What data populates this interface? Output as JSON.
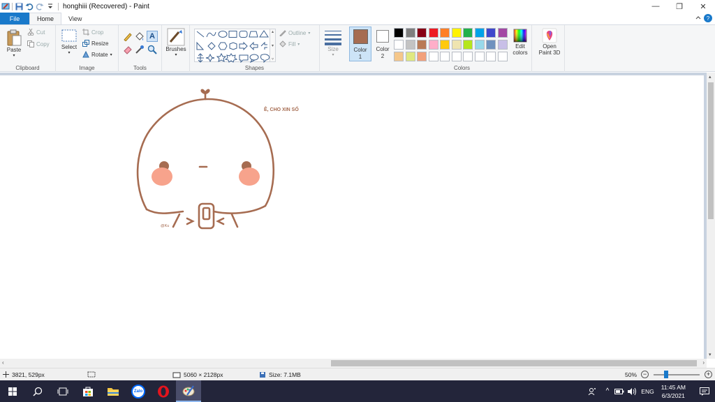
{
  "title_bar": {
    "document_title": "honghiii (Recovered) - Paint",
    "qat_icons": [
      "paint-app-icon",
      "save-icon",
      "undo-icon",
      "redo-icon",
      "customize-qat-icon"
    ],
    "minimize": "—",
    "maximize": "❐",
    "close": "✕"
  },
  "tabs": [
    "File",
    "Home",
    "View"
  ],
  "active_tab": "Home",
  "ribbon": {
    "clipboard": {
      "label": "Clipboard",
      "paste": "Paste",
      "cut": "Cut",
      "copy": "Copy"
    },
    "image": {
      "label": "Image",
      "select": "Select",
      "crop": "Crop",
      "resize": "Resize",
      "rotate": "Rotate"
    },
    "tools": {
      "label": "Tools"
    },
    "brushes": {
      "label": "Brushes"
    },
    "shapes": {
      "label": "Shapes",
      "outline": "Outline",
      "fill": "Fill"
    },
    "size": {
      "label": "Size"
    },
    "color1": {
      "label": "Color",
      "num": "1",
      "color": "#a66c51"
    },
    "color2": {
      "label": "Color",
      "num": "2",
      "color": "#ffffff"
    },
    "colors": {
      "label": "Colors",
      "palette": [
        "#000000",
        "#7f7f7f",
        "#880015",
        "#ed1c24",
        "#ff7f27",
        "#fff200",
        "#22b14c",
        "#00a2e8",
        "#3f48cc",
        "#a349a4",
        "#ffffff",
        "#c3c3c3",
        "#b97a57",
        "#ffaec9",
        "#ffc90e",
        "#efe4b0",
        "#b5e61d",
        "#99d9ea",
        "#7092be",
        "#c8bfe7",
        "#f5c78a",
        "#e0e880",
        "#f2a07b",
        "#ffffff",
        "#ffffff",
        "#ffffff",
        "#ffffff",
        "#ffffff",
        "#ffffff",
        "#ffffff"
      ],
      "edit_colors": [
        "Edit",
        "colors"
      ],
      "paint3d": [
        "Open",
        "Paint 3D"
      ]
    }
  },
  "drawing": {
    "caption": "Ê, CHO XIN SỐ",
    "signature": "@Ku",
    "stroke_color": "#a66c51",
    "cheek_color": "#f7a38c"
  },
  "status": {
    "cursor_pos": "3821, 529px",
    "image_size": "5060 × 2128px",
    "file_size": "Size: 7.1MB",
    "zoom": "50%",
    "zoom_value": 0.5
  },
  "taskbar": {
    "apps": [
      "windows-start-icon",
      "search-icon",
      "task-view-icon",
      "store-icon",
      "file-explorer-icon",
      "zalo-icon",
      "opera-icon",
      "paint-icon"
    ],
    "zalo_label": "Zalo",
    "language": "ENG",
    "time": "11:45 AM",
    "date": "6/3/2021"
  }
}
